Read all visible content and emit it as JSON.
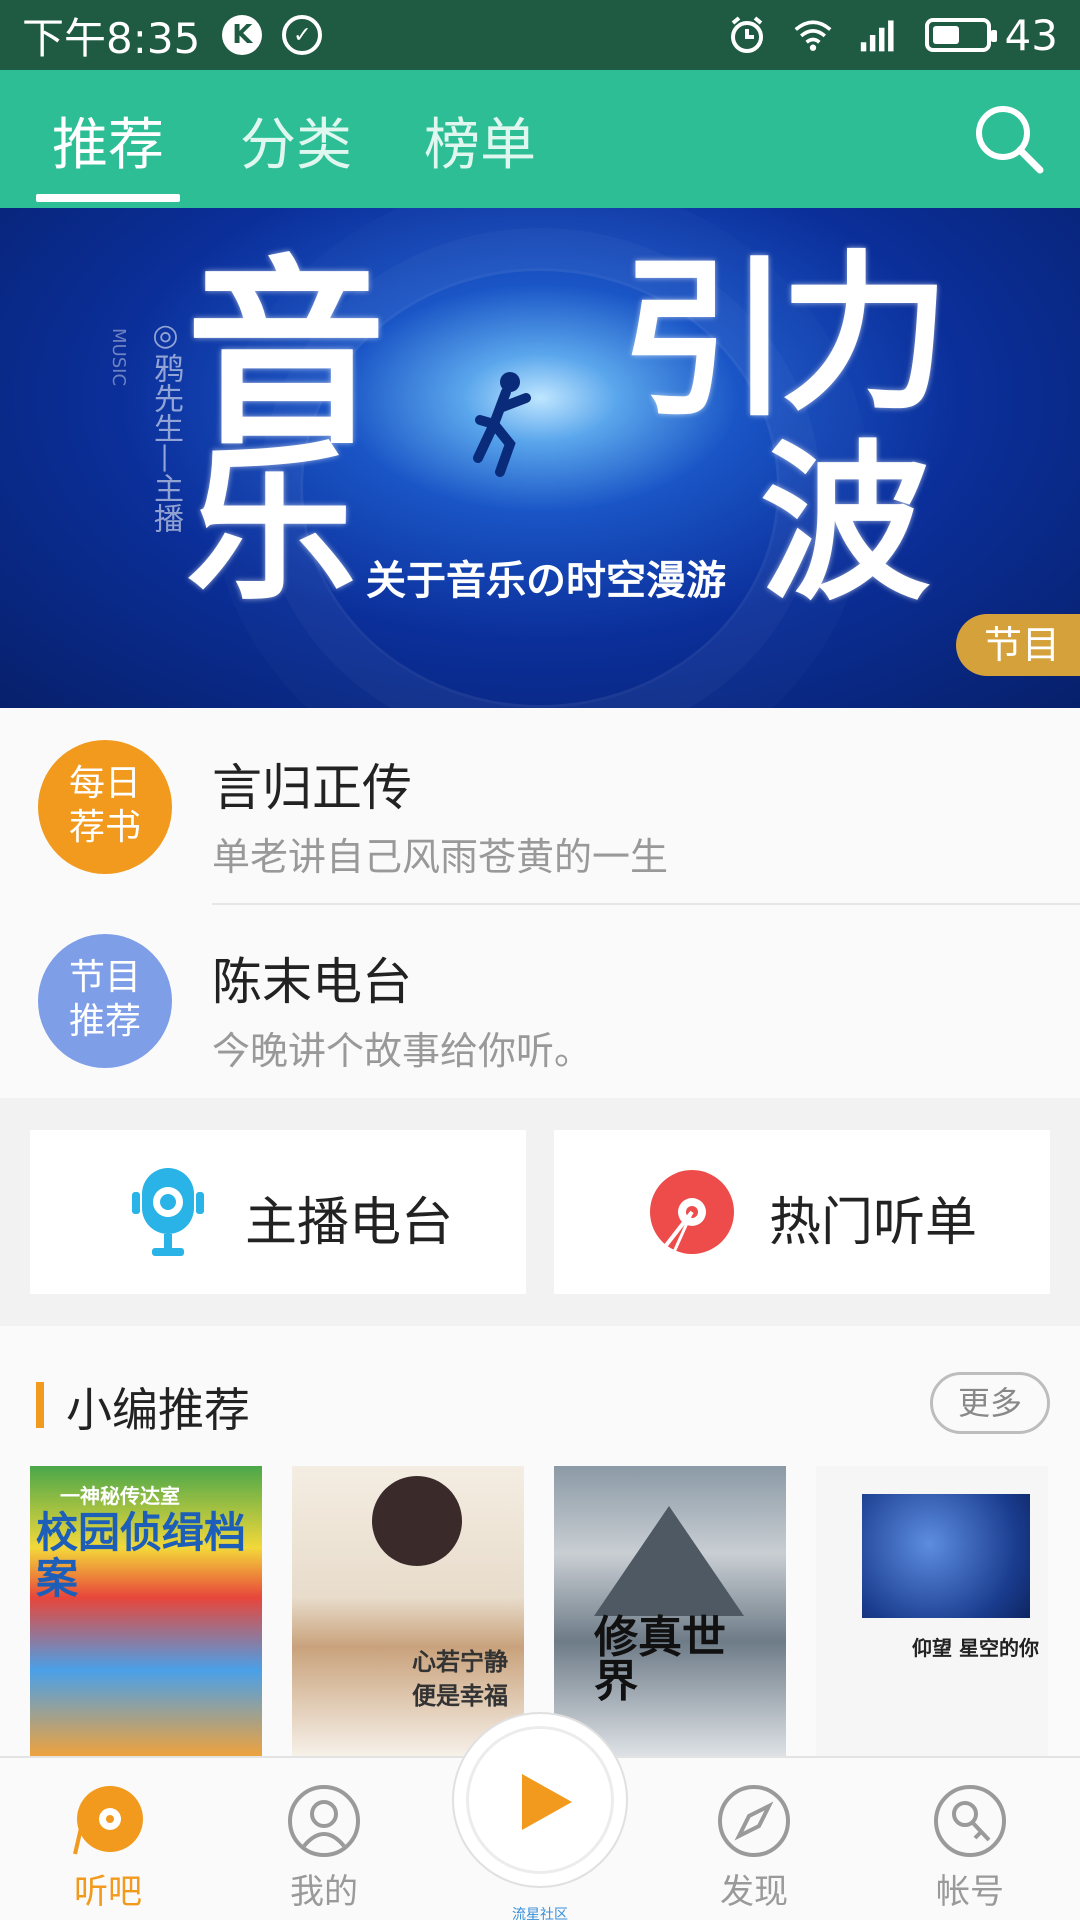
{
  "status_bar": {
    "time": "下午8:35",
    "battery": "43",
    "badge_k": "K"
  },
  "top_nav": {
    "tabs": [
      {
        "label": "推荐"
      },
      {
        "label": "分类"
      },
      {
        "label": "榜单"
      }
    ],
    "active_tab": "推荐"
  },
  "banner": {
    "big_chars": [
      "音",
      "乐",
      "引",
      "力",
      "波"
    ],
    "subtitle": "关于音乐の时空漫游",
    "side_text": "◎鸦先生—主播",
    "side_small": "MUSIC",
    "badge": "节目"
  },
  "featured": [
    {
      "badge": [
        "每日",
        "荐书"
      ],
      "badge_color": "#f19a1d",
      "title": "言归正传",
      "desc": "单老讲自己风雨苍黄的一生"
    },
    {
      "badge": [
        "节目",
        "推荐"
      ],
      "badge_color": "#7f9ee8",
      "title": "陈末电台",
      "desc": "今晚讲个故事给你听。"
    }
  ],
  "quick_entries": [
    {
      "label": "主播电台",
      "icon": "microphone-icon",
      "color": "#2ab3e6"
    },
    {
      "label": "热门听单",
      "icon": "vinyl-disc-icon",
      "color": "#ee4b4b"
    }
  ],
  "picks": {
    "title": "小编推荐",
    "more": "更多",
    "covers": [
      {
        "text": "校园侦缉档案",
        "top": "一神秘传达室"
      },
      {
        "text": "心若宁静 便是幸福"
      },
      {
        "text": "修真世界"
      },
      {
        "text": "仰望 星空的你"
      }
    ]
  },
  "bottom_nav": {
    "items": [
      {
        "label": "听吧"
      },
      {
        "label": "我的"
      },
      {
        "label": "发现"
      },
      {
        "label": "帐号"
      }
    ],
    "center_caption": "流星社区",
    "active": "听吧"
  },
  "colors": {
    "accent_green": "#2dbe96",
    "accent_orange": "#f19a1d",
    "status_bar": "#1f5a43"
  }
}
